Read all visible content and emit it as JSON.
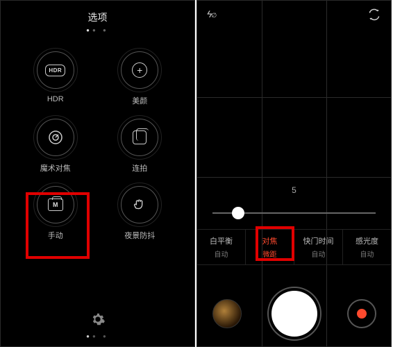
{
  "left": {
    "title": "选项",
    "options": {
      "hdr": {
        "label": "HDR",
        "icon_text": "HDR"
      },
      "beauty": {
        "label": "美颜"
      },
      "magic": {
        "label": "魔术对焦"
      },
      "burst": {
        "label": "连拍"
      },
      "manual": {
        "label": "手动",
        "icon_text": "M"
      },
      "night": {
        "label": "夜景防抖"
      }
    },
    "highlight": "manual",
    "pager": {
      "total": 3,
      "active_index": 0
    }
  },
  "right": {
    "flash": "off",
    "grid_on": true,
    "center_value": "5",
    "slider": {
      "min": 0,
      "max": 100,
      "value": 12
    },
    "params": [
      {
        "key": "wb",
        "title": "白平衡",
        "value": "自动",
        "selected": false
      },
      {
        "key": "focus",
        "title": "对焦",
        "value": "微距",
        "selected": true
      },
      {
        "key": "shutter",
        "title": "快门时间",
        "value": "自动",
        "selected": false
      },
      {
        "key": "iso",
        "title": "感光度",
        "value": "自动",
        "selected": false
      }
    ],
    "highlight": "focus",
    "accent": "#ff4a2e"
  }
}
